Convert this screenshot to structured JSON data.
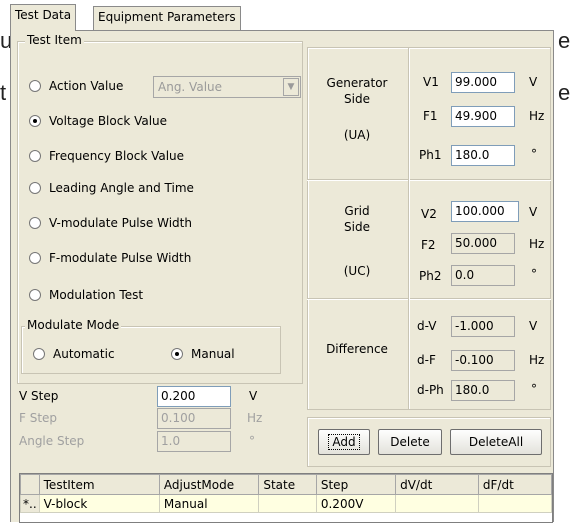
{
  "background_fragments": [
    "u",
    "e",
    "t",
    "e"
  ],
  "tabs": [
    {
      "label": "Test Data",
      "active": true
    },
    {
      "label": "Equipment Parameters",
      "active": false
    }
  ],
  "test_item": {
    "group_label": "Test Item",
    "options": [
      {
        "label": "Action Value",
        "selected": false
      },
      {
        "label": "Voltage Block Value",
        "selected": true
      },
      {
        "label": "Frequency Block Value",
        "selected": false
      },
      {
        "label": "Leading Angle and Time",
        "selected": false
      },
      {
        "label": "V-modulate Pulse Width",
        "selected": false
      },
      {
        "label": "F-modulate Pulse Width",
        "selected": false
      },
      {
        "label": "Modulation Test",
        "selected": false
      }
    ],
    "action_combo_value": "Ang. Value"
  },
  "modulate_mode": {
    "group_label": "Modulate Mode",
    "automatic_label": "Automatic",
    "manual_label": "Manual",
    "selected": "Manual"
  },
  "steps": {
    "v_step": {
      "label": "V Step",
      "value": "0.200",
      "unit": "V"
    },
    "f_step": {
      "label": "F Step",
      "value": "0.100",
      "unit": "Hz"
    },
    "angle_step": {
      "label": "Angle Step",
      "value": "1.0",
      "unit": "°"
    }
  },
  "generator": {
    "title_line1": "Generator",
    "title_line2": "Side",
    "code": "(UA)",
    "v1": {
      "label": "V1",
      "value": "99.000",
      "unit": "V"
    },
    "f1": {
      "label": "F1",
      "value": "49.900",
      "unit": "Hz"
    },
    "ph1": {
      "label": "Ph1",
      "value": "180.0",
      "unit": "°"
    }
  },
  "grid_side": {
    "title_line1": "Grid",
    "title_line2": "Side",
    "code": "(UC)",
    "v2": {
      "label": "V2",
      "value": "100.000",
      "unit": "V"
    },
    "f2": {
      "label": "F2",
      "value": "50.000",
      "unit": "Hz"
    },
    "ph2": {
      "label": "Ph2",
      "value": "0.0",
      "unit": "°"
    }
  },
  "difference": {
    "title": "Difference",
    "dv": {
      "label": "d-V",
      "value": "-1.000",
      "unit": "V"
    },
    "df": {
      "label": "d-F",
      "value": "-0.100",
      "unit": "Hz"
    },
    "dph": {
      "label": "d-Ph",
      "value": "180.0",
      "unit": "°"
    }
  },
  "buttons": {
    "add": "Add",
    "delete": "Delete",
    "delete_all": "DeleteAll"
  },
  "table": {
    "headers": [
      "",
      "TestItem",
      "AdjustMode",
      "State",
      "Step",
      "dV/dt",
      "dF/dt"
    ],
    "rows": [
      [
        "*..",
        "V-block",
        "Manual",
        "",
        "0.200V",
        "",
        ""
      ]
    ]
  }
}
